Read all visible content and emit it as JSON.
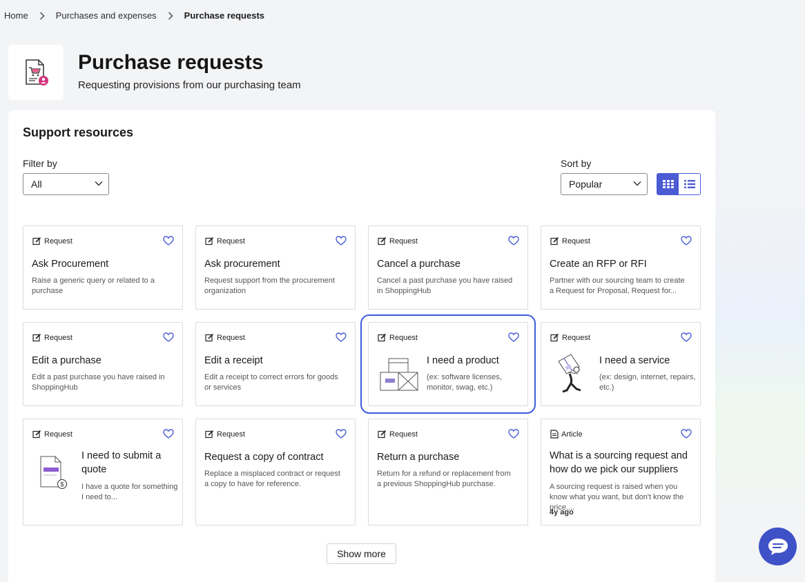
{
  "breadcrumb": {
    "home": "Home",
    "parent": "Purchases and expenses",
    "current": "Purchase requests"
  },
  "header": {
    "title": "Purchase requests",
    "subtitle": "Requesting provisions from our purchasing team"
  },
  "support": {
    "title": "Support resources",
    "filter_label": "Filter by",
    "filter_value": "All",
    "sort_label": "Sort by",
    "sort_value": "Popular",
    "view_mode": "grid"
  },
  "cards": [
    {
      "type": "Request",
      "title": "Ask Procurement",
      "desc": "Raise a generic query or related to a purchase"
    },
    {
      "type": "Request",
      "title": "Ask procurement",
      "desc": "Request support from the procurement organization"
    },
    {
      "type": "Request",
      "title": "Cancel a purchase",
      "desc": "Cancel a past purchase you have raised in ShoppingHub"
    },
    {
      "type": "Request",
      "title": "Create an RFP or RFI",
      "desc": "Partner with our sourcing team to create a Request for Proposal, Request for..."
    },
    {
      "type": "Request",
      "title": "Edit a purchase",
      "desc": "Edit a past purchase you have raised in ShoppingHub"
    },
    {
      "type": "Request",
      "title": "Edit a receipt",
      "desc": "Edit a receipt to correct errors for goods or services"
    },
    {
      "type": "Request",
      "title": "I need a product",
      "desc": "(ex: software licenses, monitor, swag, etc.)"
    },
    {
      "type": "Request",
      "title": "I need a service",
      "desc": "(ex: design, internet, repairs, etc.)"
    },
    {
      "type": "Request",
      "title": "I need to submit a quote",
      "desc": "I have a quote for something I need to..."
    },
    {
      "type": "Request",
      "title": "Request a copy of contract",
      "desc": "Replace a misplaced contract or request a copy to have for reference."
    },
    {
      "type": "Request",
      "title": "Return a purchase",
      "desc": "Return for a refund or replacement from a previous ShoppingHub purchase."
    },
    {
      "type": "Article",
      "title": "What is a sourcing request and how do we pick our suppliers",
      "desc": "A sourcing request is raised when you know what you want, but don't know the price....",
      "age": "4y ago"
    }
  ],
  "show_more": "Show more",
  "colors": {
    "accent": "#4a5bd4",
    "selected_outline": "#3b5bdb",
    "heart": "#4a5bd4",
    "chat": "#3f51c7"
  }
}
